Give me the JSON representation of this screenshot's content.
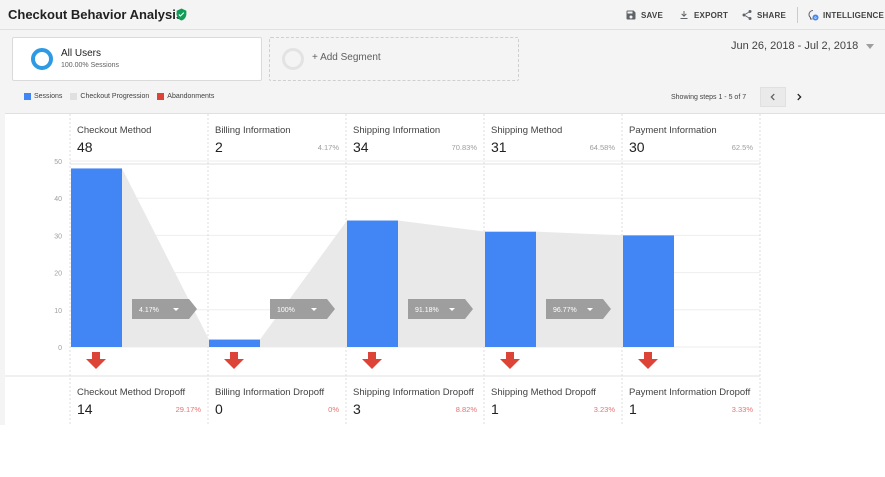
{
  "header": {
    "title": "Checkout Behavior Analysis",
    "actions": {
      "save": "SAVE",
      "export": "EXPORT",
      "share": "SHARE",
      "intelligence": "INTELLIGENCE",
      "intelligence_badge": "0"
    }
  },
  "segments": {
    "active": {
      "name": "All Users",
      "sub": "100.00% Sessions"
    },
    "add_label": "+ Add Segment"
  },
  "date_range": "Jun 26, 2018 - Jul 2, 2018",
  "legend": [
    {
      "label": "Sessions",
      "color": "#4285f4"
    },
    {
      "label": "Checkout Progression",
      "color": "#e0e0e0"
    },
    {
      "label": "Abandonments",
      "color": "#db4437"
    }
  ],
  "steps_label": "Showing steps 1 - 5 of 7",
  "colors": {
    "sessions": "#4285f4",
    "progression": "#e9e9e9",
    "abandon": "#db4437",
    "tag": "#9e9e9e"
  },
  "chart_data": {
    "type": "bar",
    "categories": [
      "Checkout Method",
      "Billing Information",
      "Shipping Information",
      "Shipping Method",
      "Payment Information"
    ],
    "values": [
      48,
      2,
      34,
      31,
      30
    ],
    "percentages": [
      "",
      "4.17%",
      "70.83%",
      "64.58%",
      "62.5%"
    ],
    "progression_labels": [
      "4.17%",
      "100%",
      "91.18%",
      "96.77%"
    ],
    "y_ticks": [
      "50",
      "40",
      "30",
      "20",
      "10",
      "0"
    ],
    "ylim": [
      0,
      50
    ],
    "grid": true,
    "dropoffs": [
      {
        "name": "Checkout Method Dropoff",
        "value": "14",
        "pct": "29.17%"
      },
      {
        "name": "Billing Information Dropoff",
        "value": "0",
        "pct": "0%"
      },
      {
        "name": "Shipping Information Dropoff",
        "value": "3",
        "pct": "8.82%"
      },
      {
        "name": "Shipping Method Dropoff",
        "value": "1",
        "pct": "3.23%"
      },
      {
        "name": "Payment Information Dropoff",
        "value": "1",
        "pct": "3.33%"
      }
    ]
  }
}
